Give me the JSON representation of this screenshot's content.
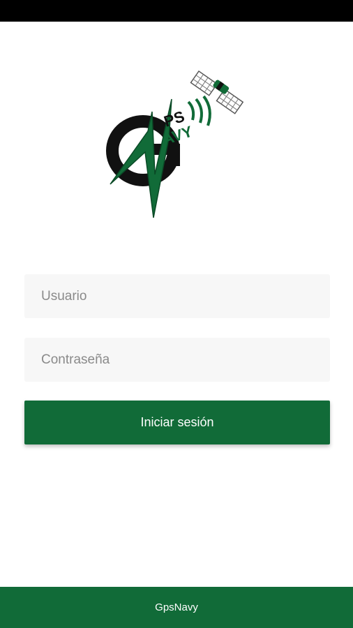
{
  "colors": {
    "brand_green": "#116b38",
    "status_bar": "#000000",
    "field_background": "#f7f7f7",
    "placeholder_text": "#8a8a8a"
  },
  "logo": {
    "name": "gpsnavy-logo",
    "text_ps": "PS",
    "text_avy": "AVY"
  },
  "login_form": {
    "username": {
      "value": "",
      "placeholder": "Usuario"
    },
    "password": {
      "value": "",
      "placeholder": "Contraseña"
    },
    "submit_label": "Iniciar sesión"
  },
  "footer": {
    "app_name": "GpsNavy"
  }
}
